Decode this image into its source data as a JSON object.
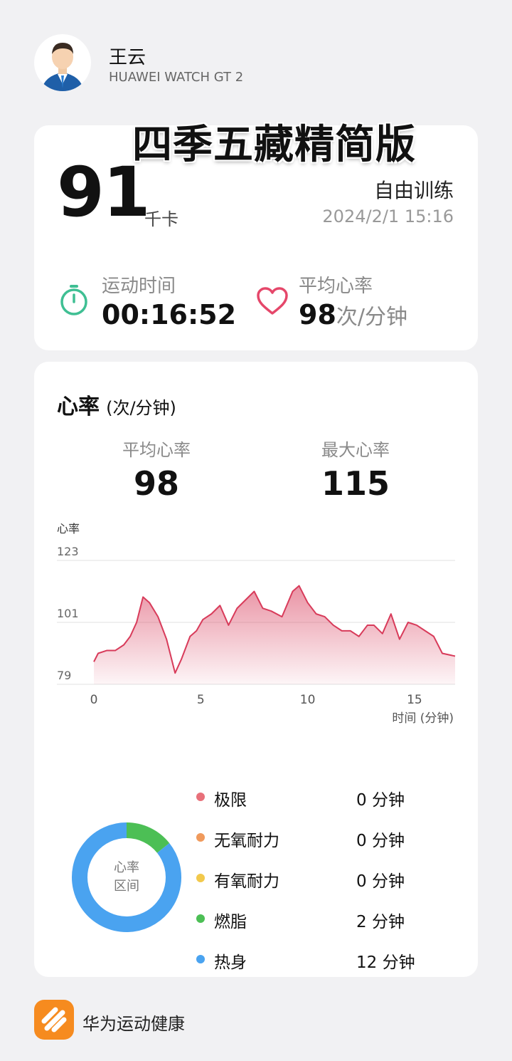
{
  "user": {
    "name": "王云",
    "device": "HUAWEI WATCH GT 2"
  },
  "watermark": "四季五藏精简版",
  "summary": {
    "calories_value": "91",
    "calories_unit": "千卡",
    "activity_title": "自由训练",
    "datetime": "2024/2/1 15:16",
    "duration_label": "运动时间",
    "duration_value": "00:16:52",
    "avg_hr_label": "平均心率",
    "avg_hr_value": "98",
    "avg_hr_unit": "次/分钟"
  },
  "heart_rate": {
    "title": "心率",
    "title_unit": "(次/分钟)",
    "avg_label": "平均心率",
    "avg_value": "98",
    "max_label": "最大心率",
    "max_value": "115"
  },
  "chart_data": {
    "type": "area",
    "ylabel": "心率",
    "xlabel": "时间 (分钟)",
    "ylim": [
      79,
      123
    ],
    "xlim": [
      0,
      16.9
    ],
    "y_ticks": [
      "123",
      "101",
      "79"
    ],
    "x_ticks": [
      "0",
      "5",
      "10",
      "15"
    ],
    "grid": true,
    "color": "#d83b5a",
    "points": [
      [
        0.0,
        87
      ],
      [
        0.2,
        90
      ],
      [
        0.6,
        91
      ],
      [
        1.0,
        91
      ],
      [
        1.4,
        93
      ],
      [
        1.7,
        96
      ],
      [
        2.0,
        101
      ],
      [
        2.3,
        110
      ],
      [
        2.6,
        108
      ],
      [
        3.0,
        103
      ],
      [
        3.4,
        95
      ],
      [
        3.8,
        83
      ],
      [
        4.1,
        88
      ],
      [
        4.5,
        96
      ],
      [
        4.8,
        98
      ],
      [
        5.1,
        102
      ],
      [
        5.5,
        104
      ],
      [
        5.9,
        107
      ],
      [
        6.3,
        100
      ],
      [
        6.7,
        106
      ],
      [
        7.1,
        109
      ],
      [
        7.5,
        112
      ],
      [
        7.9,
        106
      ],
      [
        8.3,
        105
      ],
      [
        8.8,
        103
      ],
      [
        9.3,
        112
      ],
      [
        9.6,
        114
      ],
      [
        10.0,
        108
      ],
      [
        10.4,
        104
      ],
      [
        10.8,
        103
      ],
      [
        11.2,
        100
      ],
      [
        11.6,
        98
      ],
      [
        12.0,
        98
      ],
      [
        12.4,
        96
      ],
      [
        12.8,
        100
      ],
      [
        13.1,
        100
      ],
      [
        13.5,
        97
      ],
      [
        13.9,
        104
      ],
      [
        14.3,
        95
      ],
      [
        14.7,
        101
      ],
      [
        15.1,
        100
      ],
      [
        15.5,
        98
      ],
      [
        15.9,
        96
      ],
      [
        16.3,
        90
      ],
      [
        16.9,
        89
      ]
    ]
  },
  "zones": {
    "center_line1": "心率",
    "center_line2": "区间",
    "items": [
      {
        "name": "极限",
        "value": "0 分钟",
        "minutes": 0,
        "color": "#e8707a"
      },
      {
        "name": "无氧耐力",
        "value": "0 分钟",
        "minutes": 0,
        "color": "#f09a5c"
      },
      {
        "name": "有氧耐力",
        "value": "0 分钟",
        "minutes": 0,
        "color": "#f2c94c"
      },
      {
        "name": "燃脂",
        "value": "2 分钟",
        "minutes": 2,
        "color": "#4cbf55"
      },
      {
        "name": "热身",
        "value": "12 分钟",
        "minutes": 12,
        "color": "#4aa3f0"
      }
    ]
  },
  "footer": {
    "app_name": "华为运动健康"
  }
}
